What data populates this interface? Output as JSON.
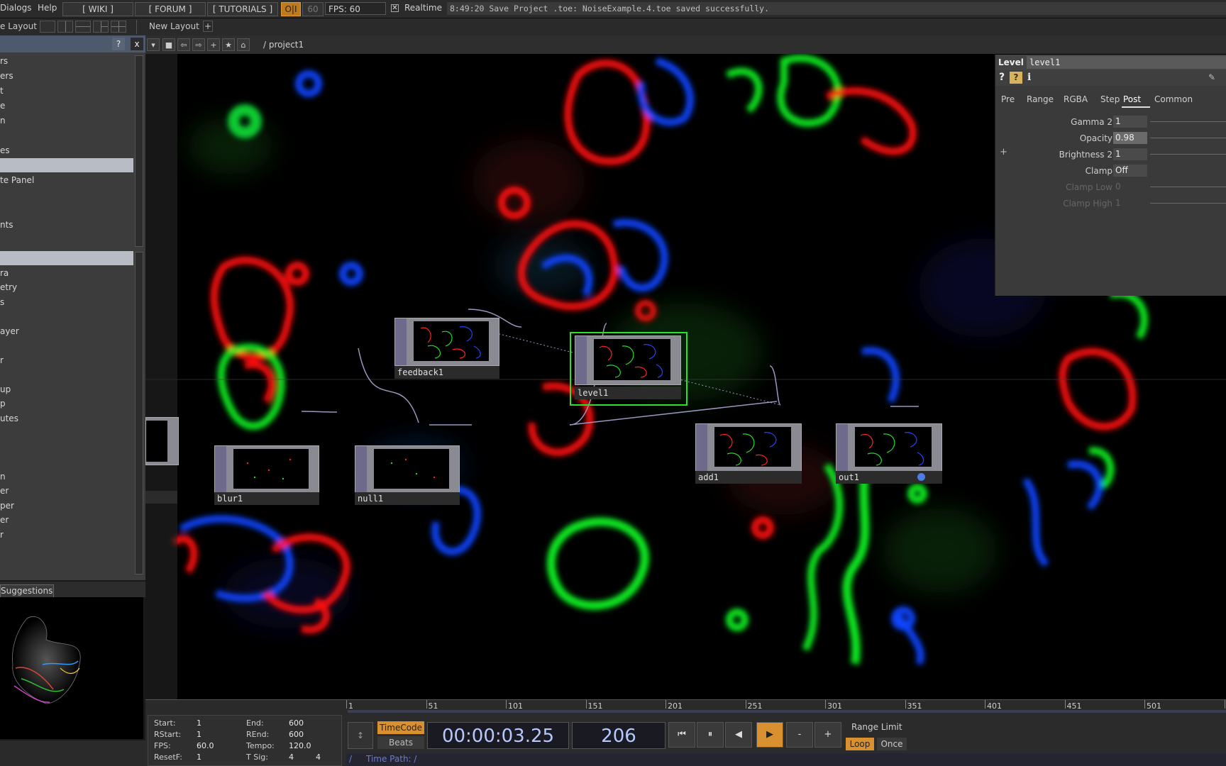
{
  "menubar": {
    "dialogs": "Dialogs",
    "help": "Help",
    "wiki": "[ WIKI ]",
    "forum": "[ FORUM ]",
    "tutorials": "[ TUTORIALS ]",
    "perf": "O|I",
    "fps_target": "60",
    "fps_label": "FPS:",
    "fps_value": "60",
    "realtime": "Realtime",
    "status": "8:49:20 Save Project .toe: NoiseExample.4.toe saved successfully."
  },
  "layoutbar": {
    "layout_label": "e Layout",
    "new_layout": "New Layout",
    "add": "+"
  },
  "left_panel": {
    "help_btn": "?",
    "close_btn": "x",
    "items_top": [
      "rs",
      "ers",
      "t",
      "e",
      "n",
      "",
      "es",
      "",
      "te Panel",
      "",
      "",
      "nts"
    ],
    "items_bottom": [
      "",
      "ra",
      "etry",
      "s",
      "",
      "ayer",
      "",
      "r",
      "",
      "up",
      "p",
      "utes",
      "",
      "",
      "",
      "n",
      "er",
      "per",
      "er",
      "r"
    ],
    "suggestions_tab": "Suggestions"
  },
  "net_toolbar": {
    "path": "/ project1"
  },
  "nodes": {
    "feedback": "feedback1",
    "level": "level1",
    "blur": "blur1",
    "null": "null1",
    "add": "add1",
    "out": "out1"
  },
  "param_panel": {
    "op_type": "Level",
    "op_name": "level1",
    "tabs": [
      "Pre",
      "Range",
      "RGBA",
      "Step",
      "Post",
      "Common"
    ],
    "params": [
      {
        "label": "Gamma 2",
        "value": "1"
      },
      {
        "label": "Opacity",
        "value": "0.98"
      },
      {
        "label": "Brightness 2",
        "value": "1"
      },
      {
        "label": "Clamp",
        "value": "Off"
      },
      {
        "label": "Clamp Low",
        "value": "0"
      },
      {
        "label": "Clamp High",
        "value": "1"
      }
    ],
    "plus": "+"
  },
  "timeline": {
    "ticks": [
      "1",
      "51",
      "101",
      "151",
      "201",
      "251",
      "301",
      "351",
      "401",
      "451",
      "501",
      "5"
    ],
    "range": {
      "start_label": "Start:",
      "start": "1",
      "end_label": "End:",
      "end": "600",
      "rstart_label": "RStart:",
      "rstart": "1",
      "rend_label": "REnd:",
      "rend": "600",
      "fps_label": "FPS:",
      "fps": "60.0",
      "tempo_label": "Tempo:",
      "tempo": "120.0",
      "resetf_label": "ResetF:",
      "resetf": "1",
      "tsig_label": "T Sig:",
      "tsig_a": "4",
      "tsig_b": "4"
    },
    "timecode_btn": "TimeCode",
    "beats_btn": "Beats",
    "timecode": "00:00:03.25",
    "frame": "206",
    "range_limit": "Range Limit",
    "loop": "Loop",
    "once": "Once",
    "time_path_label": "Time Path: /",
    "slash": "/",
    "minus": "-",
    "plus": "+"
  }
}
